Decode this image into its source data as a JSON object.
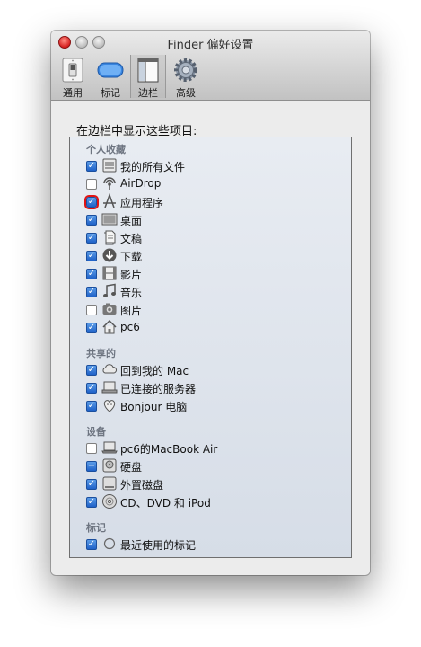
{
  "window": {
    "title": "Finder 偏好设置"
  },
  "toolbar": {
    "general": "通用",
    "tags": "标记",
    "sidebar": "边栏",
    "advanced": "高级"
  },
  "heading": "在边栏中显示这些项目:",
  "sections": {
    "favorites": "个人收藏",
    "shared": "共享的",
    "devices": "设备",
    "tags": "标记"
  },
  "items": {
    "all_files": "我的所有文件",
    "airdrop": "AirDrop",
    "applications": "应用程序",
    "desktop": "桌面",
    "documents": "文稿",
    "downloads": "下载",
    "movies": "影片",
    "music": "音乐",
    "pictures": "图片",
    "home": "pc6",
    "back_to_my_mac": "回到我的 Mac",
    "connected_servers": "已连接的服务器",
    "bonjour": "Bonjour 电脑",
    "macbook_air": "pc6的MacBook Air",
    "hard_disks": "硬盘",
    "external_disks": "外置磁盘",
    "cd_dvd_ipod": "CD、DVD 和 iPod",
    "recent_tags": "最近使用的标记"
  },
  "checkbox_glyphs": {
    "checked": "✓",
    "mixed": "−"
  },
  "states": {
    "all_files": "checked",
    "airdrop": "unchecked",
    "applications": "checked",
    "desktop": "checked",
    "documents": "checked",
    "downloads": "checked",
    "movies": "checked",
    "music": "checked",
    "pictures": "unchecked",
    "home": "checked",
    "back_to_my_mac": "checked",
    "connected_servers": "checked",
    "bonjour": "checked",
    "macbook_air": "unchecked",
    "hard_disks": "mixed",
    "external_disks": "checked",
    "cd_dvd_ipod": "checked",
    "recent_tags": "checked"
  },
  "icons": {
    "all_files": "all-files-icon",
    "airdrop": "airdrop-icon",
    "applications": "applications-icon",
    "desktop": "desktop-icon",
    "documents": "documents-icon",
    "downloads": "downloads-icon",
    "movies": "movies-icon",
    "music": "music-icon",
    "pictures": "pictures-icon",
    "home": "home-icon",
    "back_to_my_mac": "cloud-icon",
    "connected_servers": "server-icon",
    "bonjour": "bonjour-icon",
    "macbook_air": "laptop-icon",
    "hard_disks": "hard-disk-icon",
    "external_disks": "external-disk-icon",
    "cd_dvd_ipod": "cd-icon",
    "recent_tags": "tag-circle-icon"
  },
  "highlight": {
    "item": "applications",
    "color": "#e01414"
  },
  "colors": {
    "checkbox_blue": "#1f62c8",
    "section_gray": "#6d7480"
  }
}
